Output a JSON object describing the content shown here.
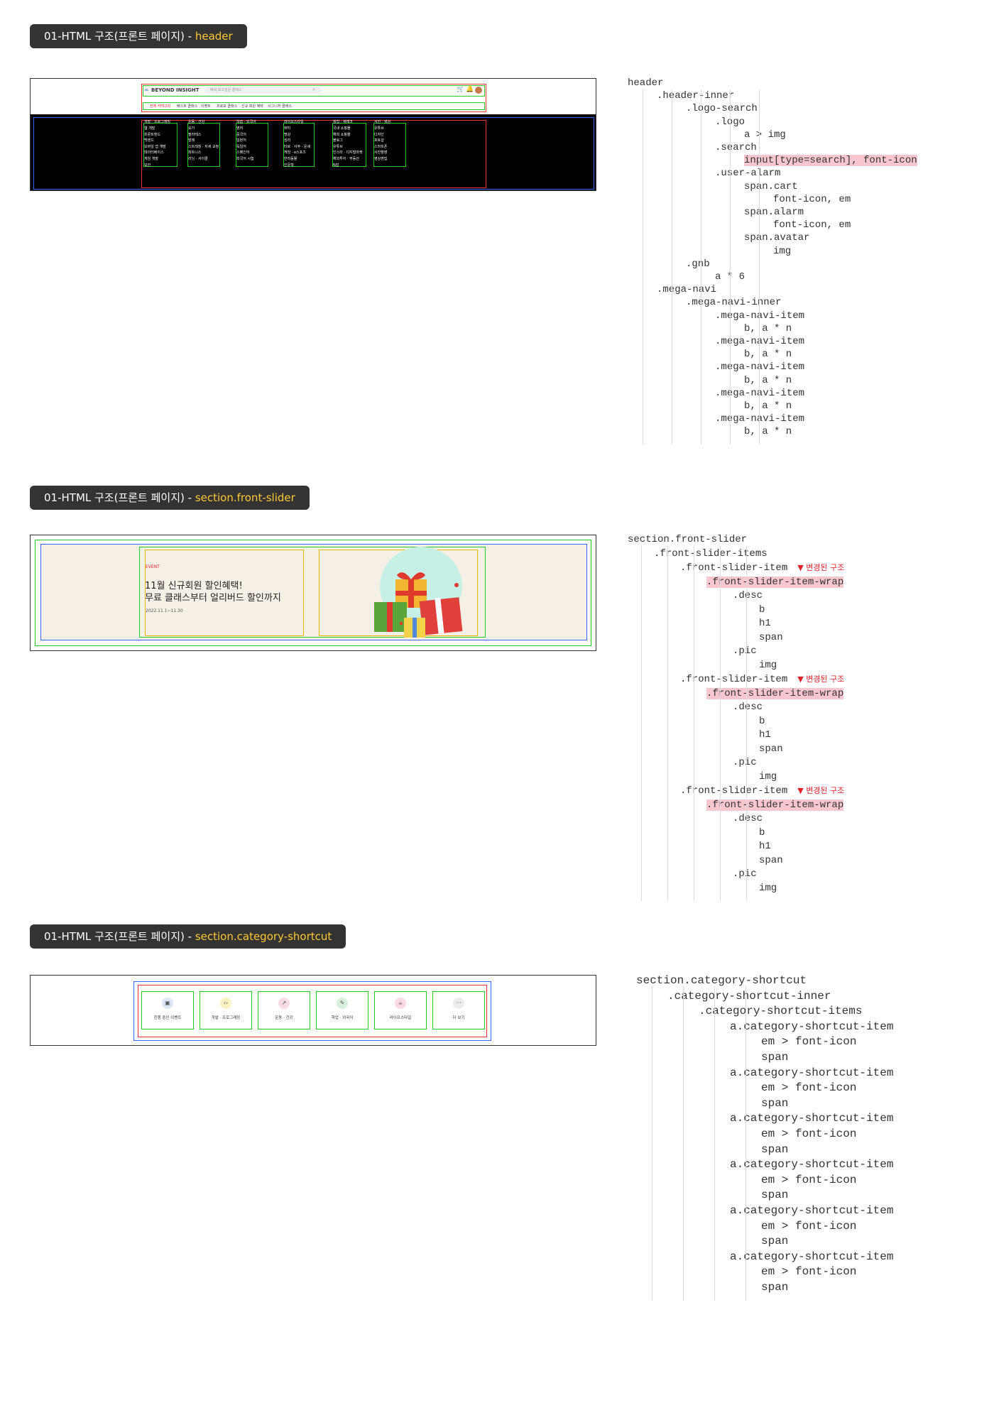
{
  "sections": [
    {
      "prefix": "01-HTML 구조(프론트 페이지) - ",
      "highlight": "header"
    },
    {
      "prefix": "01-HTML 구조(프론트 페이지) - ",
      "highlight": "section.front-slider"
    },
    {
      "prefix": "01-HTML 구조(프론트 페이지) - ",
      "highlight": "section.category-shortcut"
    }
  ],
  "header_shot": {
    "logo": "BEYOND INSIGHT",
    "search_placeholder": "배워 보고싶은 클래스",
    "gnb": [
      "전체 카테고리",
      "베스트 클래스",
      "이벤트",
      "프로모 클래스",
      "신규 회원 혜택",
      "시그니처 클래스"
    ],
    "mega_titles": [
      "개발 · 프로그래밍",
      "운동 · 건강",
      "학습 · 외국어",
      "라이프스타일",
      "창업 · 재테크",
      "사진 · 영상"
    ],
    "mega_cols": [
      [
        "웹 개발",
        "프론트엔드",
        "백엔드",
        "모바일 앱 개발",
        "데이터베이스",
        "게임 개발",
        "보안"
      ],
      [
        "요가",
        "필라테스",
        "발레",
        "스트레칭 · 자세 교정",
        "피트니스",
        "러닝 · 사이클"
      ],
      [
        "영어",
        "중국어",
        "일본어",
        "독일어",
        "스페인어",
        "외국어 시험"
      ],
      [
        "뷰티",
        "명상",
        "심리",
        "타로 · 사주 · 운세",
        "게임 · e스포츠",
        "반려동물",
        "인문학"
      ],
      [
        "국내 쇼핑몰",
        "해외 쇼핑몰",
        "블로그",
        "유튜브",
        "인스타 · 디지털마켓",
        "해외투자 · 부동산",
        "N잡"
      ],
      [
        "유튜브",
        "디자인",
        "포토샵",
        "스마트폰",
        "사진촬영",
        "영상편집"
      ]
    ]
  },
  "slider_shot": {
    "event": "EVENT",
    "title_line1": "11월 신규회원 할인혜택!",
    "title_line2": "무료 클래스부터 얼리버드 할인까지",
    "date": "2022.11.1~11.30"
  },
  "category_shot": {
    "items": [
      {
        "label": "진행 중인 이벤트",
        "icon": "calendar-icon",
        "color": "#dbe6f7",
        "glyph": "▣"
      },
      {
        "label": "개발 · 프로그래밍",
        "icon": "code-icon",
        "color": "#fbf2c4",
        "glyph": "‹›"
      },
      {
        "label": "운동 · 건강",
        "icon": "chart-icon",
        "color": "#fadbe5",
        "glyph": "↗"
      },
      {
        "label": "학업 · 외국어",
        "icon": "chat-icon",
        "color": "#d8f0dd",
        "glyph": "✎"
      },
      {
        "label": "라이프스타일",
        "icon": "cup-icon",
        "color": "#fadbe5",
        "glyph": "☕"
      },
      {
        "label": "더 보기",
        "icon": "more-icon",
        "color": "#ececec",
        "glyph": "···"
      }
    ]
  },
  "tree_header": [
    {
      "depth": 0,
      "text": "header"
    },
    {
      "depth": 1,
      "text": ".header-inner"
    },
    {
      "depth": 2,
      "text": ".logo-search"
    },
    {
      "depth": 3,
      "text": ".logo"
    },
    {
      "depth": 4,
      "text": "a > img"
    },
    {
      "depth": 3,
      "text": ".search"
    },
    {
      "depth": 4,
      "text": "input[type=search], font-icon",
      "mark": true
    },
    {
      "depth": 3,
      "text": ".user-alarm"
    },
    {
      "depth": 4,
      "text": "span.cart"
    },
    {
      "depth": 5,
      "text": "font-icon, em"
    },
    {
      "depth": 4,
      "text": "span.alarm"
    },
    {
      "depth": 5,
      "text": "font-icon, em"
    },
    {
      "depth": 4,
      "text": "span.avatar"
    },
    {
      "depth": 5,
      "text": "img"
    },
    {
      "depth": 2,
      "text": ".gnb"
    },
    {
      "depth": 3,
      "text": "a * 6"
    },
    {
      "depth": 1,
      "text": ".mega-navi"
    },
    {
      "depth": 2,
      "text": ".mega-navi-inner"
    },
    {
      "depth": 3,
      "text": ".mega-navi-item"
    },
    {
      "depth": 4,
      "text": "b, a * n"
    },
    {
      "depth": 3,
      "text": ".mega-navi-item"
    },
    {
      "depth": 4,
      "text": "b, a * n"
    },
    {
      "depth": 3,
      "text": ".mega-navi-item"
    },
    {
      "depth": 4,
      "text": "b, a * n"
    },
    {
      "depth": 3,
      "text": ".mega-navi-item"
    },
    {
      "depth": 4,
      "text": "b, a * n"
    },
    {
      "depth": 3,
      "text": ".mega-navi-item"
    },
    {
      "depth": 4,
      "text": "b, a * n"
    }
  ],
  "tree_slider": [
    {
      "depth": 0,
      "text": "section.front-slider"
    },
    {
      "depth": 1,
      "text": ".front-slider-items"
    },
    {
      "depth": 2,
      "text": ".front-slider-item",
      "note": "▼ 변경된 구조"
    },
    {
      "depth": 3,
      "text": ".front-slider-item-wrap",
      "mark": true
    },
    {
      "depth": 4,
      "text": ".desc"
    },
    {
      "depth": 5,
      "text": "b"
    },
    {
      "depth": 5,
      "text": "h1"
    },
    {
      "depth": 5,
      "text": "span"
    },
    {
      "depth": 4,
      "text": ".pic"
    },
    {
      "depth": 5,
      "text": "img"
    },
    {
      "depth": 2,
      "text": ".front-slider-item",
      "note": "▼ 변경된 구조"
    },
    {
      "depth": 3,
      "text": ".front-slider-item-wrap",
      "mark": true
    },
    {
      "depth": 4,
      "text": ".desc"
    },
    {
      "depth": 5,
      "text": "b"
    },
    {
      "depth": 5,
      "text": "h1"
    },
    {
      "depth": 5,
      "text": "span"
    },
    {
      "depth": 4,
      "text": ".pic"
    },
    {
      "depth": 5,
      "text": "img"
    },
    {
      "depth": 2,
      "text": ".front-slider-item",
      "note": "▼ 변경된 구조"
    },
    {
      "depth": 3,
      "text": ".front-slider-item-wrap",
      "mark": true
    },
    {
      "depth": 4,
      "text": ".desc"
    },
    {
      "depth": 5,
      "text": "b"
    },
    {
      "depth": 5,
      "text": "h1"
    },
    {
      "depth": 5,
      "text": "span"
    },
    {
      "depth": 4,
      "text": ".pic"
    },
    {
      "depth": 5,
      "text": "img"
    }
  ],
  "tree_category": [
    {
      "depth": 0,
      "text": "section.category-shortcut"
    },
    {
      "depth": 1,
      "text": ".category-shortcut-inner"
    },
    {
      "depth": 2,
      "text": ".category-shortcut-items"
    },
    {
      "depth": 3,
      "text": "a.category-shortcut-item"
    },
    {
      "depth": 4,
      "text": "em > font-icon"
    },
    {
      "depth": 4,
      "text": "span"
    },
    {
      "depth": 3,
      "text": "a.category-shortcut-item"
    },
    {
      "depth": 4,
      "text": "em > font-icon"
    },
    {
      "depth": 4,
      "text": "span"
    },
    {
      "depth": 3,
      "text": "a.category-shortcut-item"
    },
    {
      "depth": 4,
      "text": "em > font-icon"
    },
    {
      "depth": 4,
      "text": "span"
    },
    {
      "depth": 3,
      "text": "a.category-shortcut-item"
    },
    {
      "depth": 4,
      "text": "em > font-icon"
    },
    {
      "depth": 4,
      "text": "span"
    },
    {
      "depth": 3,
      "text": "a.category-shortcut-item"
    },
    {
      "depth": 4,
      "text": "em > font-icon"
    },
    {
      "depth": 4,
      "text": "span"
    },
    {
      "depth": 3,
      "text": "a.category-shortcut-item"
    },
    {
      "depth": 4,
      "text": "em > font-icon"
    },
    {
      "depth": 4,
      "text": "span"
    }
  ]
}
